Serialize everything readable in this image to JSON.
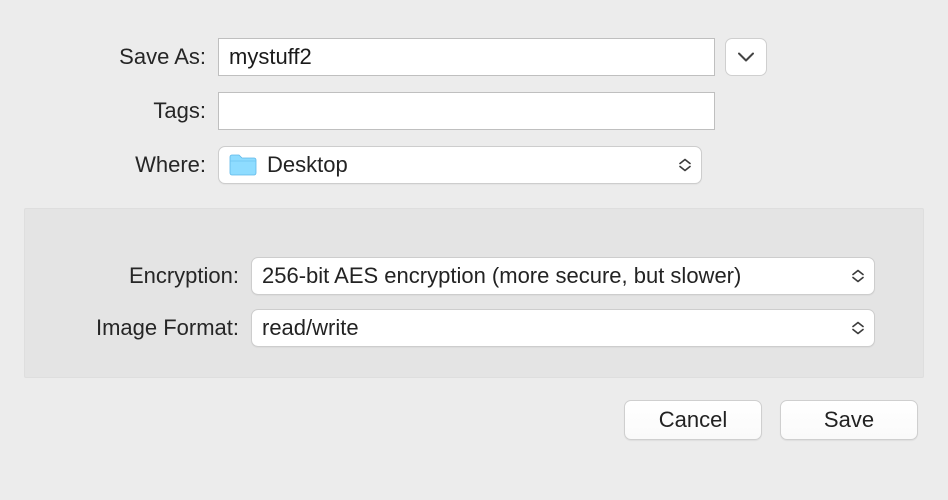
{
  "saveAs": {
    "label": "Save As:",
    "value": "mystuff2"
  },
  "tags": {
    "label": "Tags:",
    "value": ""
  },
  "where": {
    "label": "Where:",
    "selected": "Desktop"
  },
  "encryption": {
    "label": "Encryption:",
    "selected": "256-bit AES encryption (more secure, but slower)"
  },
  "imageFormat": {
    "label": "Image Format:",
    "selected": "read/write"
  },
  "buttons": {
    "cancel": "Cancel",
    "save": "Save"
  }
}
